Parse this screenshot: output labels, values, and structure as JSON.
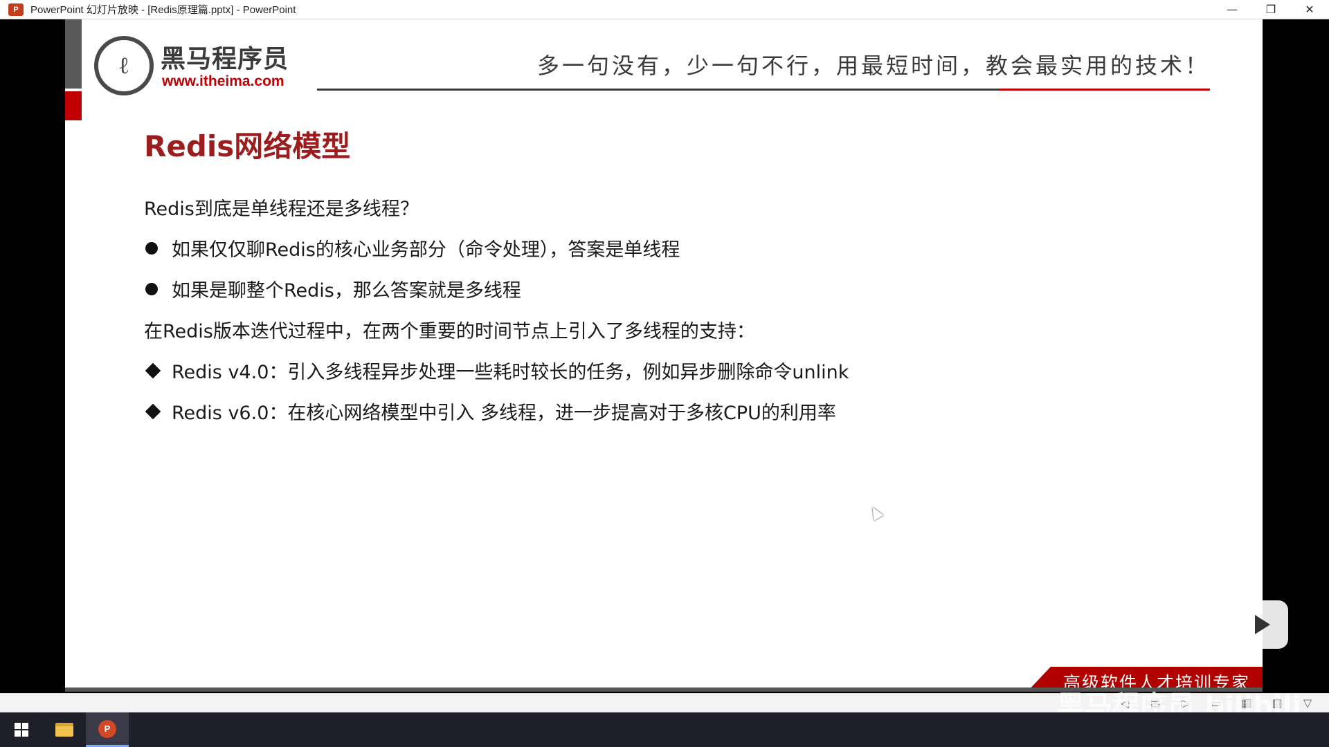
{
  "window": {
    "app_icon_letter": "P",
    "title": "PowerPoint 幻灯片放映 - [Redis原理篇.pptx] - PowerPoint",
    "minimize_glyph": "—",
    "restore_glyph": "❐",
    "close_glyph": "✕"
  },
  "slide": {
    "logo_mark": "ℓ",
    "logo_name": "黑马程序员",
    "logo_url": "www.itheima.com",
    "slogan": "多一句没有，少一句不行，用最短时间，教会最实用的技术！",
    "title": "Redis网络模型",
    "lines": [
      "Redis到底是单线程还是多线程？",
      "如果仅仅聊Redis的核心业务部分（命令处理），答案是单线程",
      "如果是聊整个Redis，那么答案就是多线程",
      "在Redis版本迭代过程中，在两个重要的时间节点上引入了多线程的支持：",
      "Redis v4.0：引入多线程异步处理一些耗时较长的任务，例如异步删除命令unlink",
      "Redis v6.0：在核心网络模型中引入 多线程，进一步提高对于多核CPU的利用率"
    ],
    "footer_slogan": "高级软件人才培训专家"
  },
  "overlay": {
    "watermark": "黑马程序员 bilibili"
  },
  "toolbar_icons": [
    "◁",
    "▤",
    "▷",
    "▭",
    "▦",
    "▥",
    "▽"
  ],
  "colors": {
    "accent_red": "#c00000",
    "title_red": "#9c1d1d",
    "dark_gray": "#3a3a3a"
  }
}
